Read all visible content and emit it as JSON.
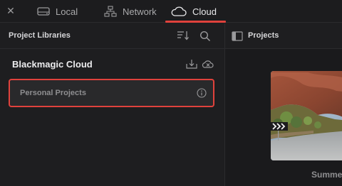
{
  "tabs": {
    "close_icon": "close-icon",
    "items": [
      {
        "label": "Local",
        "icon": "drive-icon"
      },
      {
        "label": "Network",
        "icon": "network-icon"
      },
      {
        "label": "Cloud",
        "icon": "cloud-icon"
      }
    ],
    "active": "Cloud"
  },
  "left_panel": {
    "title": "Project Libraries",
    "library": {
      "name": "Blackmagic Cloud",
      "projects": [
        {
          "label": "Personal Projects"
        }
      ]
    }
  },
  "right_panel": {
    "title": "Projects",
    "thumbnail_caption": "Summe"
  },
  "colors": {
    "accent": "#e0423c",
    "background": "#1e1e20"
  }
}
